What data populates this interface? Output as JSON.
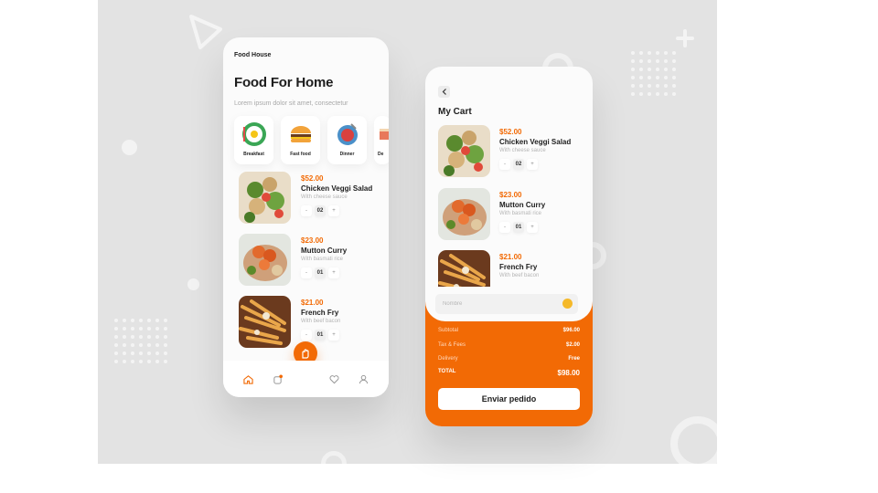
{
  "home": {
    "brand": "Food House",
    "title": "Food For Home",
    "subtitle": "Lorem ipsum dolor sit amet, consectetur",
    "categories": [
      {
        "label": "Breakfast",
        "icon": "breakfast-plate-icon"
      },
      {
        "label": "Fast food",
        "icon": "burger-icon"
      },
      {
        "label": "Dinner",
        "icon": "dinner-plate-icon"
      },
      {
        "label": "De",
        "icon": "dessert-icon"
      }
    ],
    "items": [
      {
        "price": "$52.00",
        "name": "Chicken Veggi Salad",
        "desc": "With cheese sauce",
        "qty": "02"
      },
      {
        "price": "$23.00",
        "name": "Mutton Curry",
        "desc": "With basmati rice",
        "qty": "01"
      },
      {
        "price": "$21.00",
        "name": "French Fry",
        "desc": "With beef bacon",
        "qty": "01"
      }
    ],
    "nav": [
      "home-icon",
      "orders-icon",
      "favorites-icon",
      "profile-icon"
    ]
  },
  "cart": {
    "title": "My Cart",
    "items": [
      {
        "price": "$52.00",
        "name": "Chicken Veggi Salad",
        "desc": "With cheese sauce",
        "qty": "02"
      },
      {
        "price": "$23.00",
        "name": "Mutton Curry",
        "desc": "With basmati rice",
        "qty": "01"
      },
      {
        "price": "$21.00",
        "name": "French Fry",
        "desc": "With beef bacon"
      }
    ],
    "name_placeholder": "Nombre",
    "summary": [
      {
        "key": "Subtotal",
        "value": "$96.00"
      },
      {
        "key": "Tax & Fees",
        "value": "$2.00"
      },
      {
        "key": "Delivery",
        "value": "Free"
      },
      {
        "key": "TOTAL",
        "value": "$98.00"
      }
    ],
    "cta": "Enviar pedido"
  },
  "qty_minus": "-",
  "qty_plus": "+",
  "colors": {
    "accent": "#f26a05",
    "background": "#e3e3e3",
    "card": "#fbfbfb"
  }
}
